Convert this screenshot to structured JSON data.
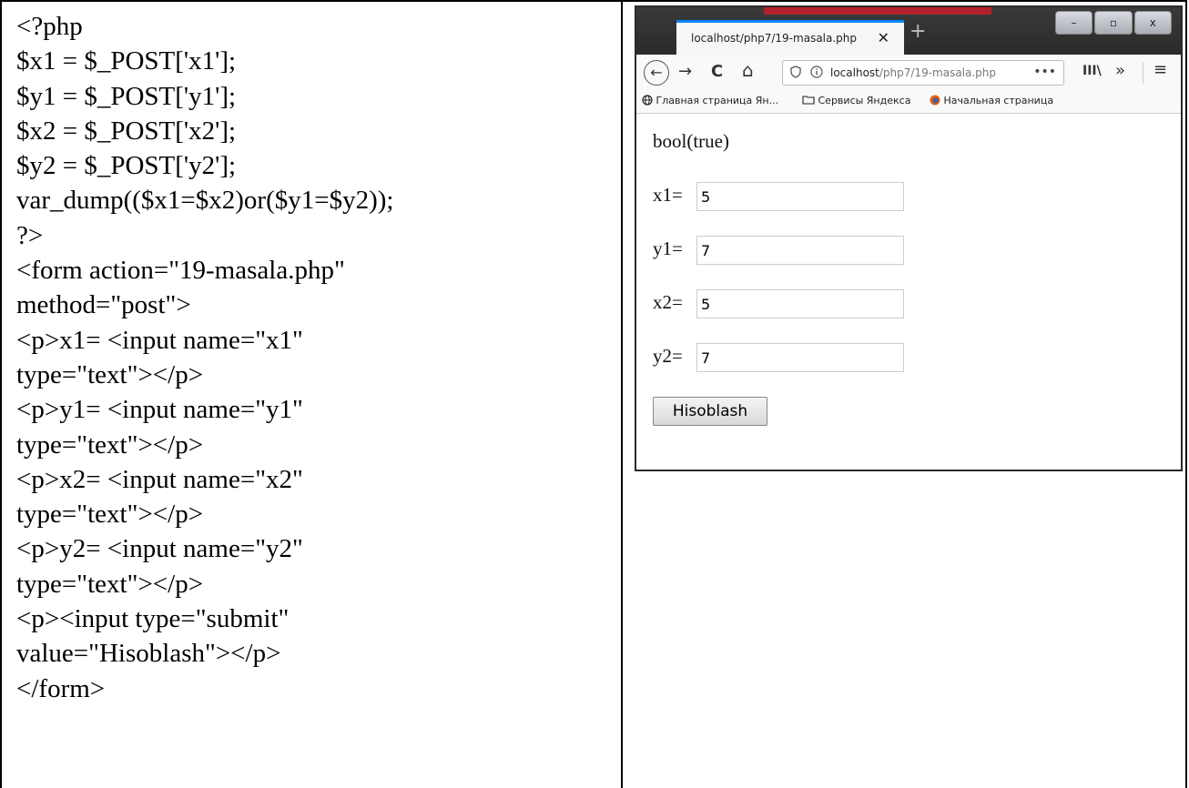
{
  "code_lines": [
    "<?php",
    "$x1 = $_POST['x1'];",
    "$y1 = $_POST['y1'];",
    "$x2 = $_POST['x2'];",
    "$y2 = $_POST['y2'];",
    "var_dump(($x1=$x2)or($y1=$y2));",
    "?>",
    "<form action=\"19-masala.php\"",
    "method=\"post\">",
    "<p>x1= <input name=\"x1\"",
    "type=\"text\"></p>",
    "<p>y1= <input name=\"y1\"",
    "type=\"text\"></p>",
    "<p>x2= <input name=\"x2\"",
    "type=\"text\"></p>",
    "<p>y2= <input name=\"y2\"",
    "type=\"text\"></p>",
    "<p><input type=\"submit\"",
    "value=\"Hisoblash\"></p>",
    "</form>"
  ],
  "browser": {
    "tab_title": "localhost/php7/19-masala.php",
    "tab_close": "✕",
    "new_tab": "+",
    "window_controls": [
      "–",
      "▫",
      "x"
    ],
    "nav": {
      "back": "←",
      "forward": "→",
      "reload": "C",
      "home": "⌂"
    },
    "url": {
      "host": "localhost",
      "path": "/php7/19-masala.php",
      "more": "•••"
    },
    "toolbar": {
      "library": "III\\",
      "overflow": "»",
      "menu": "≡"
    },
    "bookmarks": [
      "Главная страница Ян...",
      "Сервисы Яндекса",
      "Начальная страница"
    ],
    "page": {
      "output": "bool(true)",
      "fields": [
        {
          "label": "x1=",
          "value": "5"
        },
        {
          "label": "y1=",
          "value": "7"
        },
        {
          "label": "x2=",
          "value": "5"
        },
        {
          "label": "y2=",
          "value": "7"
        }
      ],
      "submit_label": "Hisoblash"
    }
  }
}
